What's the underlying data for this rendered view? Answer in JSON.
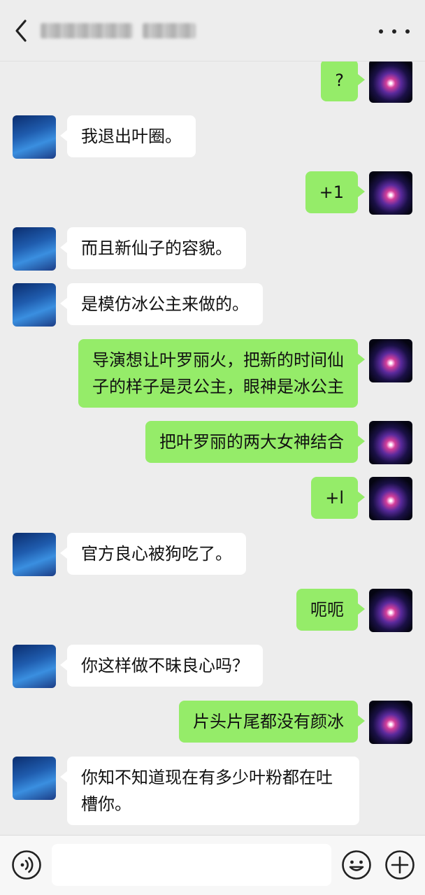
{
  "header": {
    "back_icon": "chevron-left-icon",
    "title": "",
    "more_icon": "more-dots-icon"
  },
  "avatars": {
    "contact": "princess-avatar",
    "self": "galaxy-avatar"
  },
  "messages": [
    {
      "side": "right",
      "text": "?"
    },
    {
      "side": "left",
      "text": "我退出叶圈。"
    },
    {
      "side": "right",
      "text": "+1"
    },
    {
      "side": "left",
      "text": "而且新仙子的容貌。"
    },
    {
      "side": "left",
      "text": "是模仿冰公主来做的。"
    },
    {
      "side": "right",
      "text_lines": [
        "导演想让叶罗丽火，把新的时间仙",
        "子的样子是灵公主，眼神是冰公主"
      ]
    },
    {
      "side": "right",
      "text": "把叶罗丽的两大女神结合"
    },
    {
      "side": "right",
      "text": "+l"
    },
    {
      "side": "left",
      "text": "官方良心被狗吃了。"
    },
    {
      "side": "right",
      "text": "呃呃"
    },
    {
      "side": "left",
      "text": "你这样做不昧良心吗？"
    },
    {
      "side": "right",
      "text": "片头片尾都没有颜冰"
    },
    {
      "side": "left",
      "text_lines": [
        "你知不知道现在有多少叶粉都在吐",
        "槽你。"
      ]
    }
  ],
  "input_bar": {
    "voice_icon": "voice-icon",
    "input_value": "",
    "emoji_icon": "emoji-icon",
    "plus_icon": "plus-icon"
  },
  "colors": {
    "background": "#ededed",
    "self_bubble": "#95ec69",
    "contact_bubble": "#ffffff"
  }
}
